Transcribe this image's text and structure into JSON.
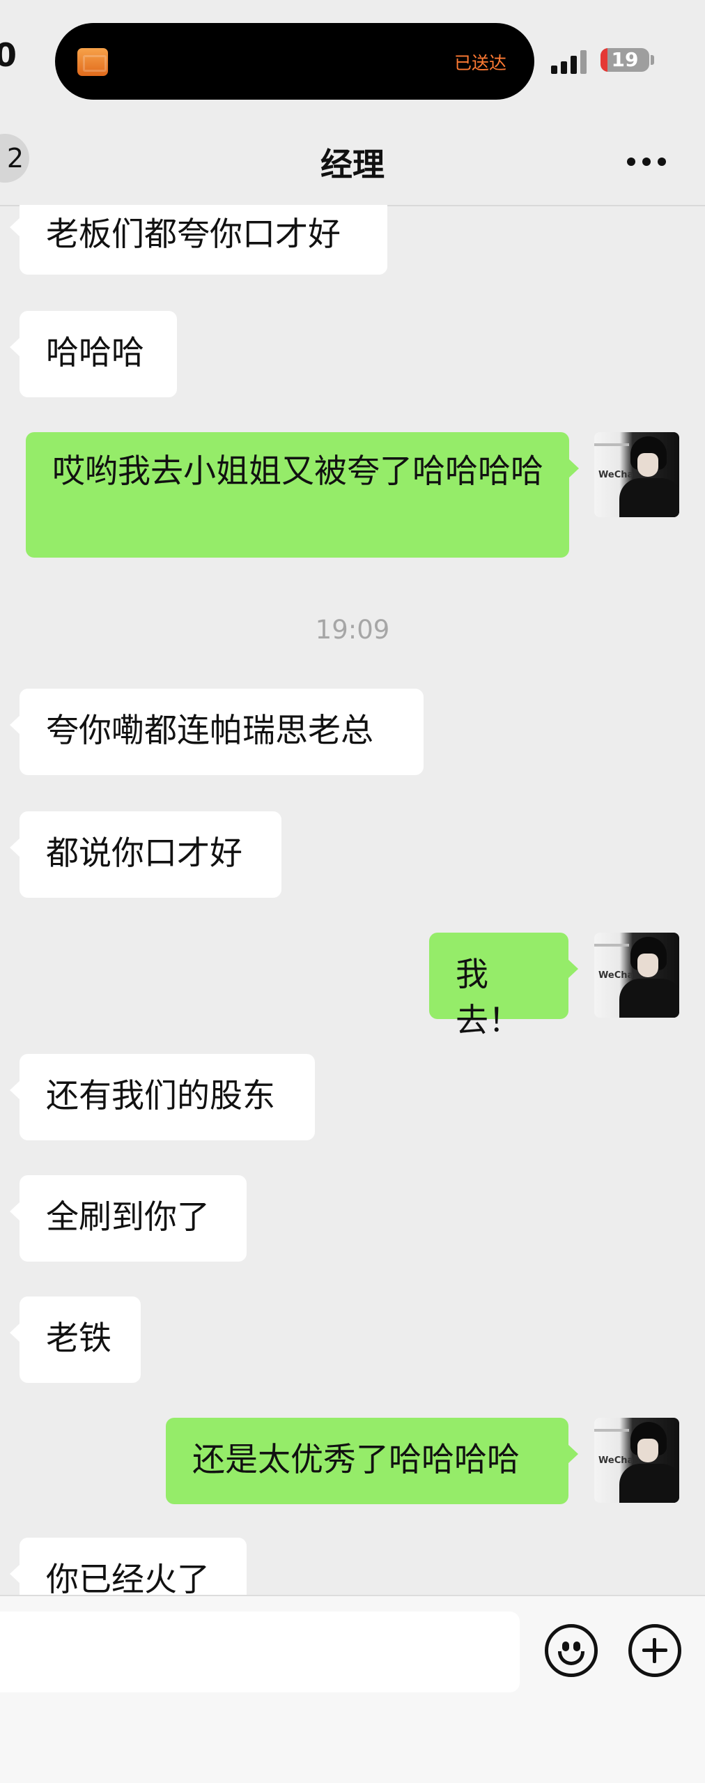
{
  "status_bar": {
    "time_fragment": "0",
    "island_status": "已送达",
    "battery_level": "19"
  },
  "header": {
    "back_badge": "2",
    "title": "经理"
  },
  "chat": {
    "messages": [
      {
        "side": "in",
        "text": "老板们都夸你口才好"
      },
      {
        "side": "in",
        "text": "哈哈哈"
      },
      {
        "side": "out",
        "text": "哎哟我去小姐姐又被夸了哈哈哈哈"
      },
      {
        "side": "in",
        "text": "夸你嘞都连帕瑞思老总"
      },
      {
        "side": "in",
        "text": "都说你口才好"
      },
      {
        "side": "out",
        "text": "我去！"
      },
      {
        "side": "in",
        "text": "还有我们的股东"
      },
      {
        "side": "in",
        "text": "全刷到你了"
      },
      {
        "side": "in",
        "text": "老铁"
      },
      {
        "side": "out",
        "text": "还是太优秀了哈哈哈哈"
      },
      {
        "side": "in",
        "text": "你已经火了"
      }
    ],
    "timestamp": "19:09"
  },
  "avatar_label": "WeCha",
  "colors": {
    "background": "#ededed",
    "incoming_bubble": "#ffffff",
    "outgoing_bubble": "#95ec69",
    "island_status": "#ff7a33"
  }
}
